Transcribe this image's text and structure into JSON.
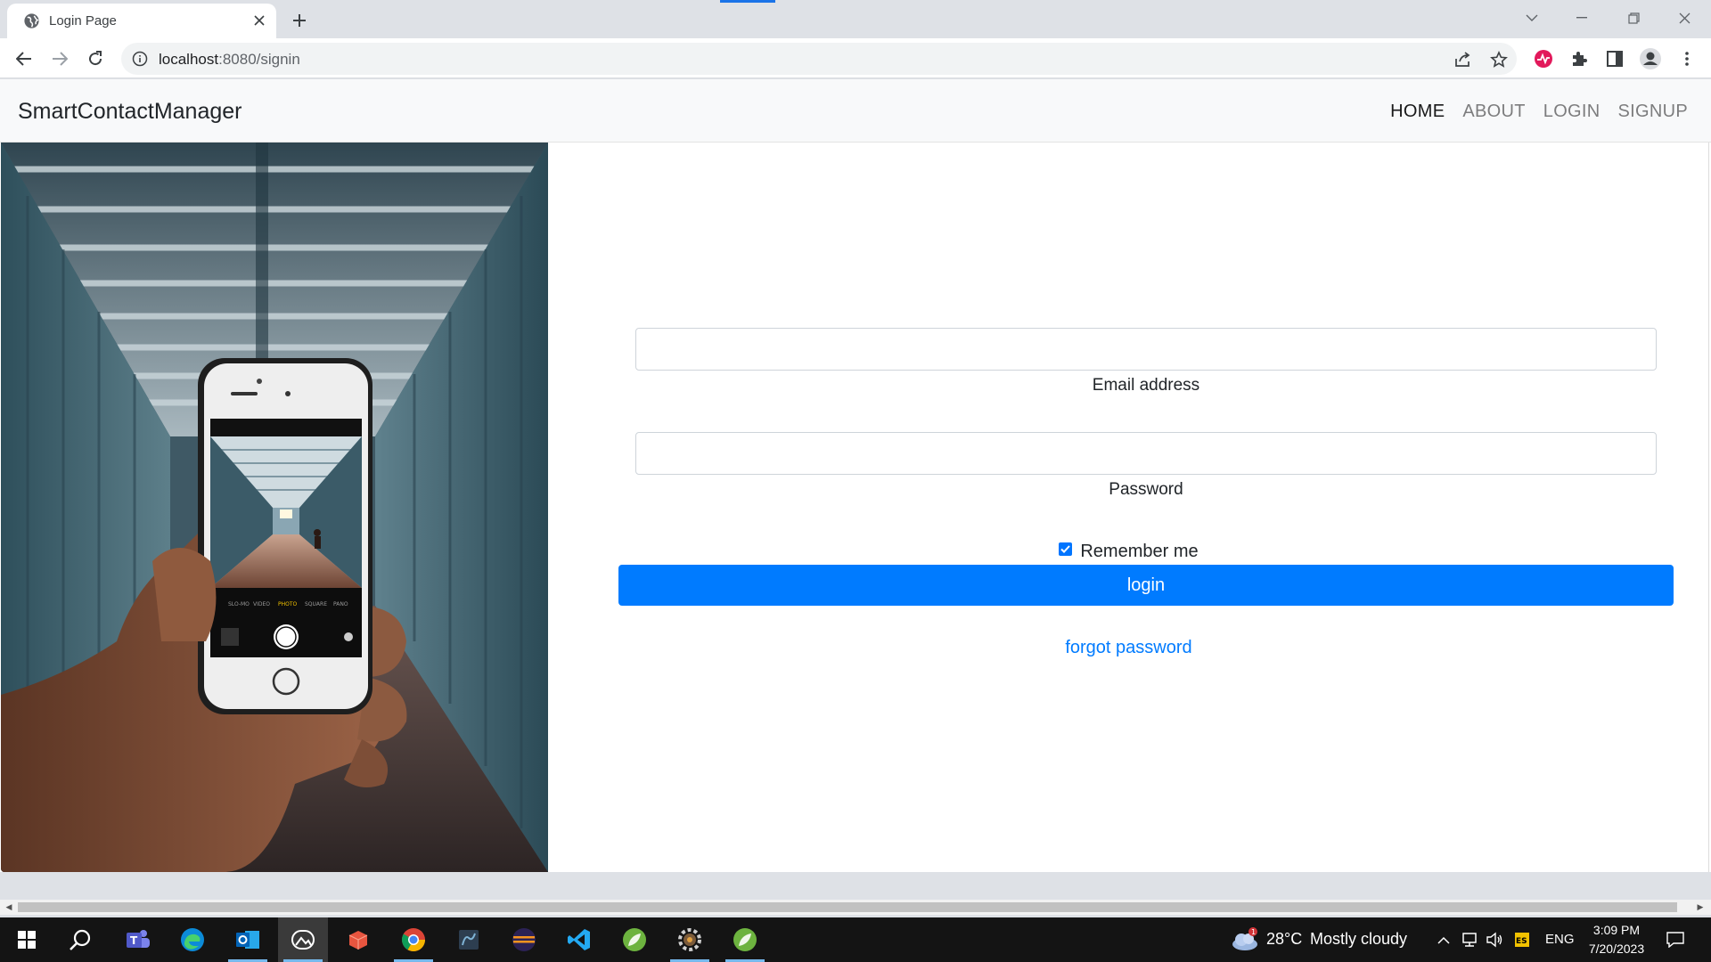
{
  "browser": {
    "tab_title": "Login Page",
    "url_host": "localhost",
    "url_rest": ":8080/signin"
  },
  "navbar": {
    "brand": "SmartContactManager",
    "links": [
      "HOME",
      "ABOUT",
      "LOGIN",
      "SIGNUP"
    ]
  },
  "form": {
    "email_label": "Email address",
    "email_value": "",
    "password_label": "Password",
    "password_value": "",
    "remember_label": "Remember me",
    "remember_checked": true,
    "login_label": "login",
    "forgot_label": "forgot password"
  },
  "taskbar": {
    "weather_temp": "28°C",
    "weather_text": "Mostly cloudy",
    "lang": "ENG",
    "time": "3:09 PM",
    "date": "7/20/2023",
    "weather_badge": "1"
  },
  "colors": {
    "primary": "#007bff",
    "navbar_bg": "#f8f9fa",
    "taskbar_bg": "#141414"
  }
}
